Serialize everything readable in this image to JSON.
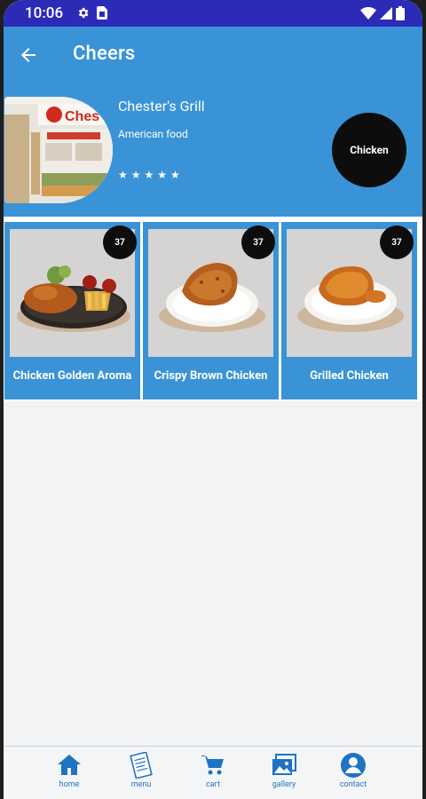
{
  "status_bar": {
    "time": "10:06"
  },
  "app_bar": {
    "title": "Cheers"
  },
  "restaurant": {
    "name": "Chester's Grill",
    "cuisine": "American food",
    "rating": "★★★★★",
    "sign_text": "Ches",
    "category": "Chicken"
  },
  "items": [
    {
      "name": "Chicken Golden Aroma",
      "price": "37"
    },
    {
      "name": "Crispy Brown Chicken",
      "price": "37"
    },
    {
      "name": "Grilled Chicken",
      "price": "37"
    }
  ],
  "bottom_nav": {
    "items": [
      {
        "label": "home",
        "icon": "home-icon"
      },
      {
        "label": "menu",
        "icon": "menu-icon"
      },
      {
        "label": "cart",
        "icon": "cart-icon"
      },
      {
        "label": "gallery",
        "icon": "gallery-icon"
      },
      {
        "label": "contact",
        "icon": "contact-icon"
      }
    ]
  },
  "colors": {
    "primary": "#3a93d6",
    "status": "#2b2bb8",
    "badge": "#0d0d0d",
    "nav_label": "#1f73c3"
  }
}
